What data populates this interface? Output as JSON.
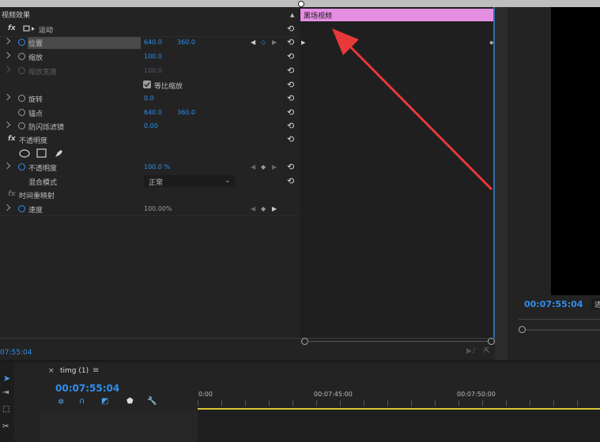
{
  "effect_controls": {
    "title": "视频效果",
    "clip_name": "黑场视频",
    "current_time": "07:55:04",
    "rows": [
      {
        "label": "运动",
        "kind": "fx"
      },
      {
        "label": "位置",
        "v1": "640.0",
        "v2": "360.0"
      },
      {
        "label": "缩放",
        "v1": "100.0"
      },
      {
        "label": "缩放宽度",
        "v1": "100.0"
      },
      {
        "label": "等比缩放"
      },
      {
        "label": "旋转",
        "v1": "0.0"
      },
      {
        "label": "锚点",
        "v1": "640.0",
        "v2": "360.0"
      },
      {
        "label": "防闪烁滤镜",
        "v1": "0.00"
      },
      {
        "label": "不透明度",
        "kind": "fx"
      },
      {
        "label": "不透明度",
        "v1": "100.0 %"
      },
      {
        "label": "混合模式",
        "v1": "正常"
      },
      {
        "label": "时间重映射",
        "kind": "fx"
      },
      {
        "label": "速度",
        "v1": "100.00%"
      }
    ]
  },
  "program_monitor": {
    "timecode": "00:07:55:04",
    "truncated_label": "适"
  },
  "sequence": {
    "tab_name": "timg (1)",
    "close_glyph": "×",
    "menu_glyph": "≡",
    "timecode": "00:07:55:04",
    "ruler": [
      "0:00",
      "00:07:45:00",
      "00:07:50:00"
    ]
  },
  "colors": {
    "accent_blue": "#2f8eea",
    "clip_pink": "#e48ee2",
    "arrow_red": "#e8383a",
    "playhead_yellow": "#d8c533"
  }
}
